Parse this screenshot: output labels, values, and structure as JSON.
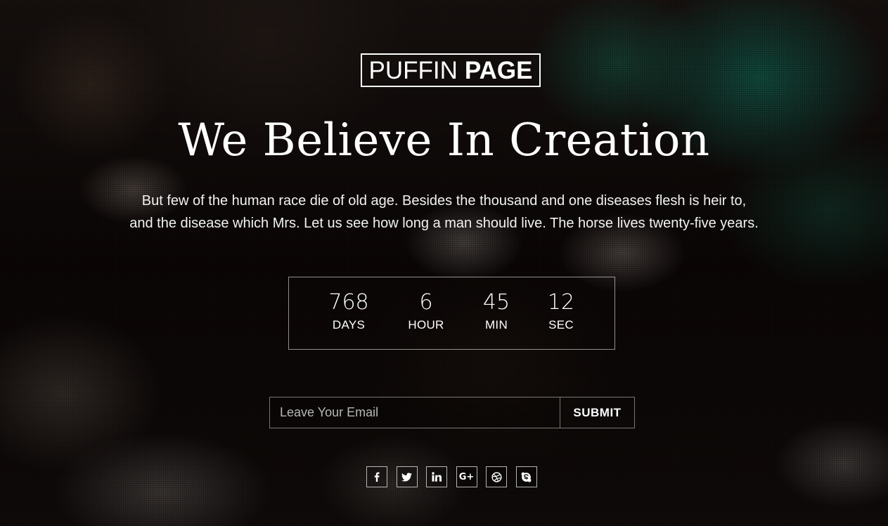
{
  "logo": {
    "word1": "PUFFIN",
    "word2": "PAGE"
  },
  "headline": "We Believe In Creation",
  "description": {
    "line1": "But few of the human race die of old age. Besides the thousand and one diseases flesh is heir to,",
    "line2": "and the disease which Mrs. Let us see how long a man should live. The horse lives twenty-five years."
  },
  "countdown": {
    "days": {
      "value": "768",
      "label": "DAYS"
    },
    "hours": {
      "value": "6",
      "label": "HOUR"
    },
    "minutes": {
      "value": "45",
      "label": "MIN"
    },
    "seconds": {
      "value": "12",
      "label": "SEC"
    }
  },
  "subscribe": {
    "email_value": "",
    "email_placeholder": "Leave Your Email",
    "submit_label": "SUBMIT"
  },
  "social": [
    {
      "icon": "facebook-icon"
    },
    {
      "icon": "twitter-icon"
    },
    {
      "icon": "linkedin-icon"
    },
    {
      "icon": "google-plus-icon"
    },
    {
      "icon": "dribbble-icon"
    },
    {
      "icon": "skype-icon"
    }
  ],
  "colors": {
    "text": "#ffffff",
    "overlay": "#000000",
    "accent_bg": "#1e8c73"
  }
}
